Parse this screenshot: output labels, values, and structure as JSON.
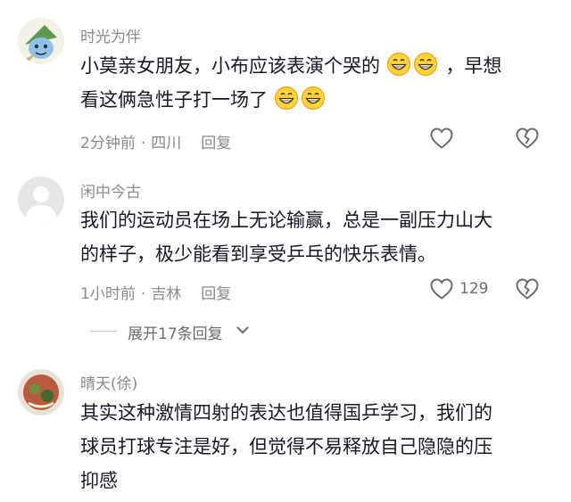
{
  "comments": [
    {
      "username": "时光为伴",
      "lines": [
        "小莫亲女朋友，小布应该表演个哭的",
        "，早想",
        "看这俩急性子打一场了"
      ],
      "time": "2分钟前",
      "location": "四川",
      "reply": "回复",
      "likes": "",
      "avatar_icon": "cartoon-character-avatar"
    },
    {
      "username": "闲中今古",
      "lines": [
        "我们的运动员在场上无论输赢，总是一副压力山大",
        "的样子，极少能看到享受乒乓的快乐表情。"
      ],
      "time": "1小时前",
      "location": "吉林",
      "reply": "回复",
      "likes": "129",
      "avatar_icon": "default-user-avatar"
    },
    {
      "username": "晴天(徐)",
      "lines": [
        "其实这种激情四射的表达也值得国乒学习，我们的",
        "球员打球专注是好，但觉得不易释放自己隐隐的压",
        "抑感"
      ],
      "avatar_icon": "photo-avatar"
    }
  ],
  "expand_replies": "展开17条回复",
  "separator": "·",
  "colors": {
    "text": "#161823",
    "secondary": "#8a8a8f",
    "icon": "#6b6b70"
  }
}
